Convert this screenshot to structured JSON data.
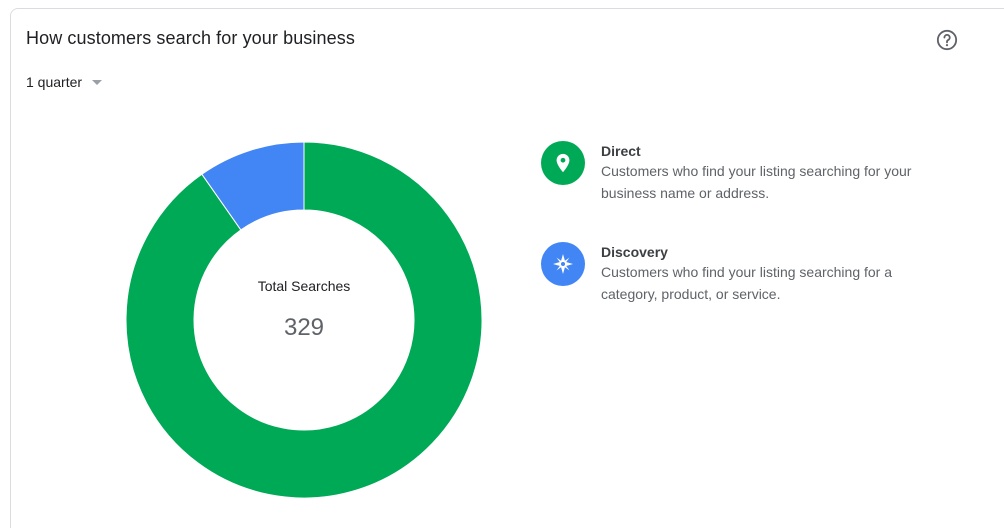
{
  "card": {
    "title": "How customers search for your business",
    "help_icon": "help-circle-icon",
    "period": {
      "selected": "1 quarter",
      "icon": "dropdown-caret-icon"
    }
  },
  "center": {
    "label": "Total Searches",
    "value": "329"
  },
  "legend": [
    {
      "name": "Direct",
      "description": "Customers who find your listing searching for your business name or address.",
      "icon": "location-pin-icon",
      "color": "#00a955"
    },
    {
      "name": "Discovery",
      "description": "Customers who find your listing searching for a category, product, or service.",
      "icon": "compass-icon",
      "color": "#4285f4"
    }
  ],
  "chart_data": {
    "type": "pie",
    "variant": "donut",
    "total": 329,
    "categories": [
      "Direct",
      "Discovery"
    ],
    "values": [
      297,
      32
    ],
    "colors": [
      "#00a955",
      "#4285f4"
    ]
  }
}
